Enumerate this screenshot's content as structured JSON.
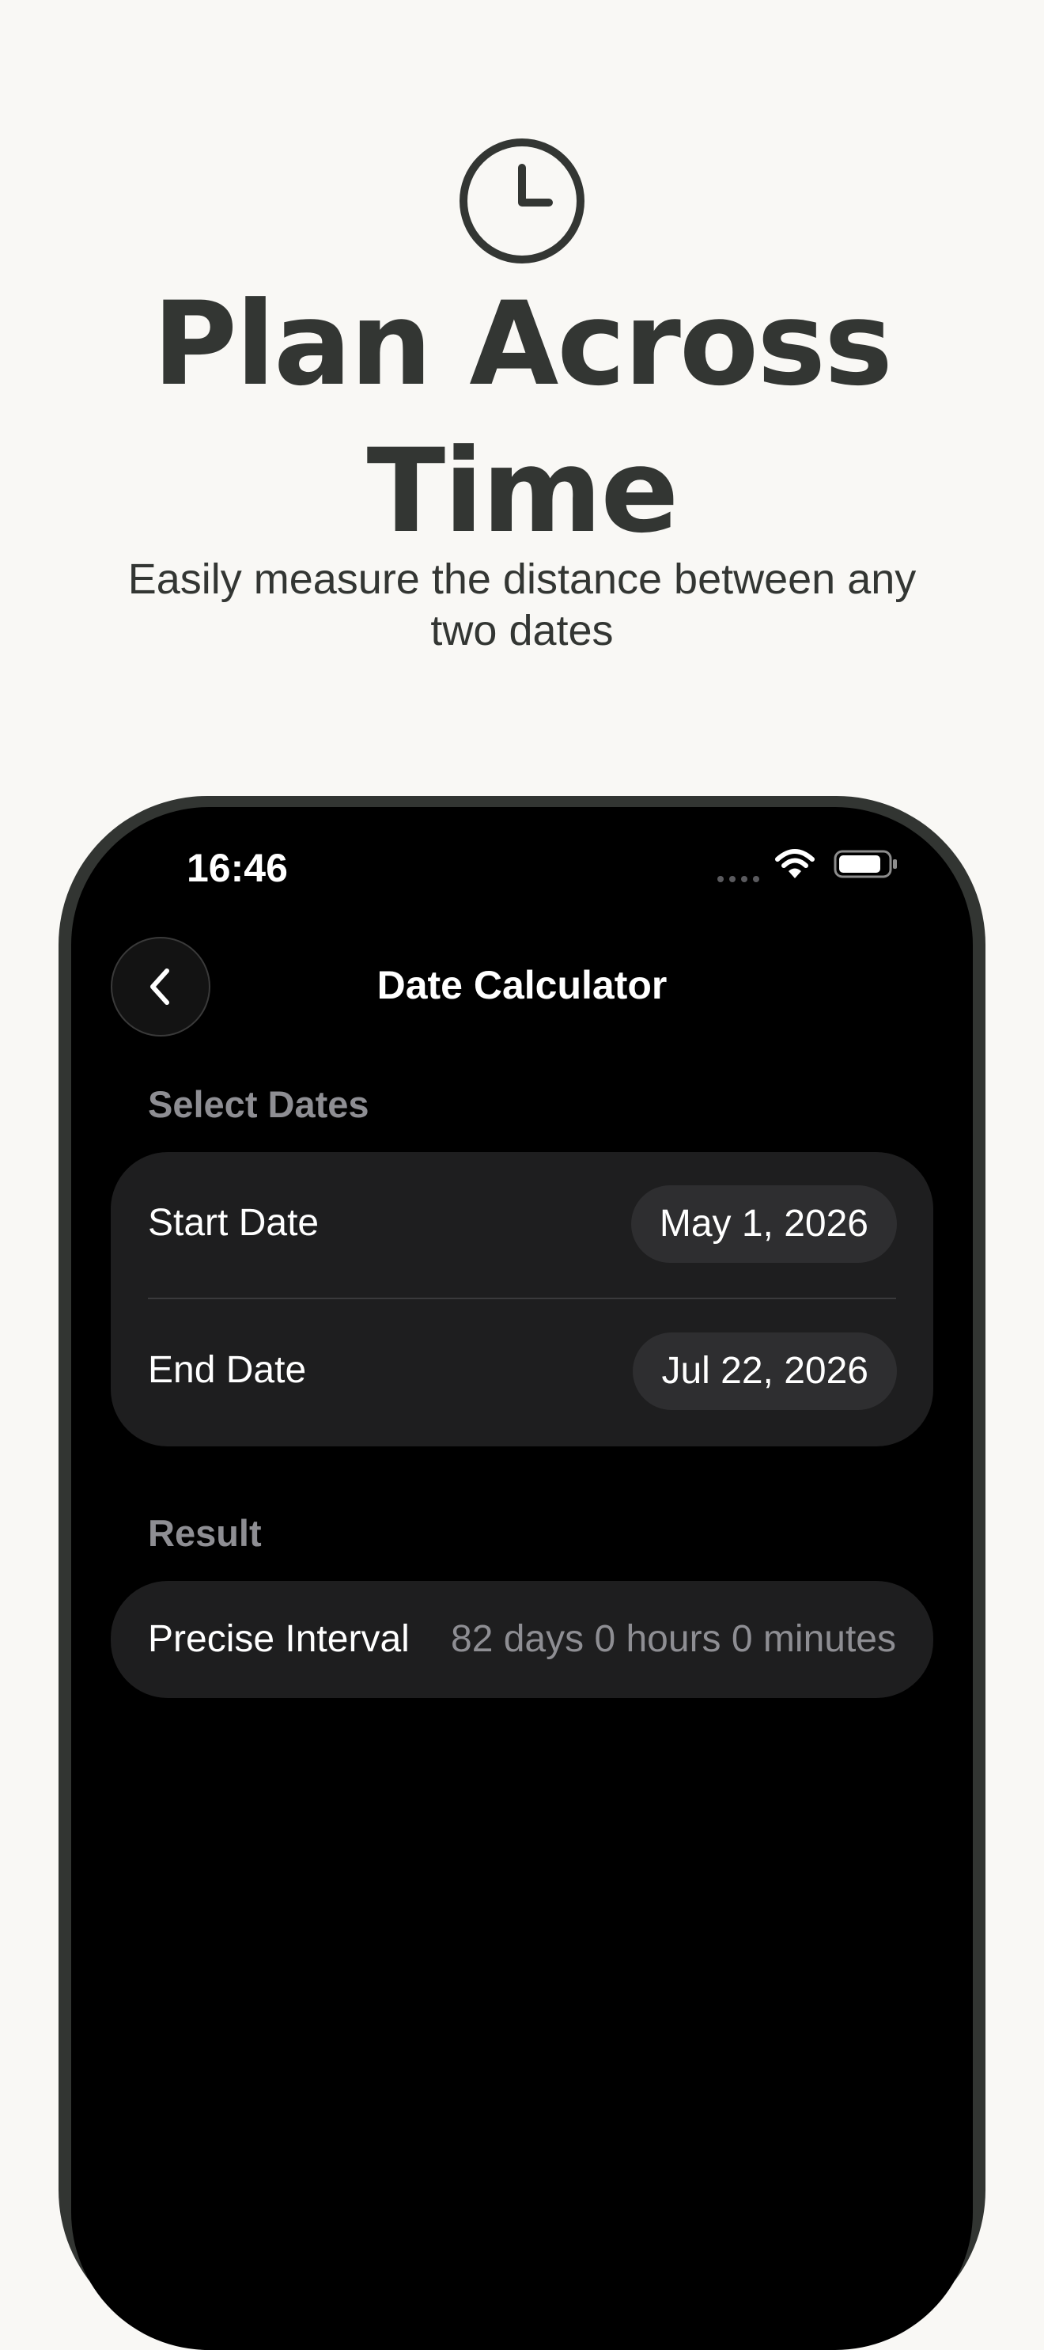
{
  "hero": {
    "headline_line1": "Plan Across",
    "headline_line2": "Time",
    "subtitle": "Easily measure the distance between any two dates",
    "icon": "clock-icon"
  },
  "status_bar": {
    "time": "16:46",
    "icons": [
      "cellular-signal-icon",
      "wifi-icon",
      "battery-icon"
    ]
  },
  "nav": {
    "title": "Date Calculator",
    "back_icon": "chevron-left-icon"
  },
  "select_dates": {
    "section_label": "Select Dates",
    "start": {
      "label": "Start Date",
      "value": "May 1, 2026"
    },
    "end": {
      "label": "End Date",
      "value": "Jul 22, 2026"
    }
  },
  "result": {
    "section_label": "Result",
    "label": "Precise Interval",
    "value": "82 days 0 hours 0 minutes"
  },
  "colors": {
    "page_background": "#f9f8f5",
    "headline_text": "#333633",
    "phone_frame": "#323532",
    "screen_background": "#000000",
    "card_background": "#1e1e1f",
    "pill_background": "#2e2e30",
    "secondary_text": "#8e8e93"
  }
}
